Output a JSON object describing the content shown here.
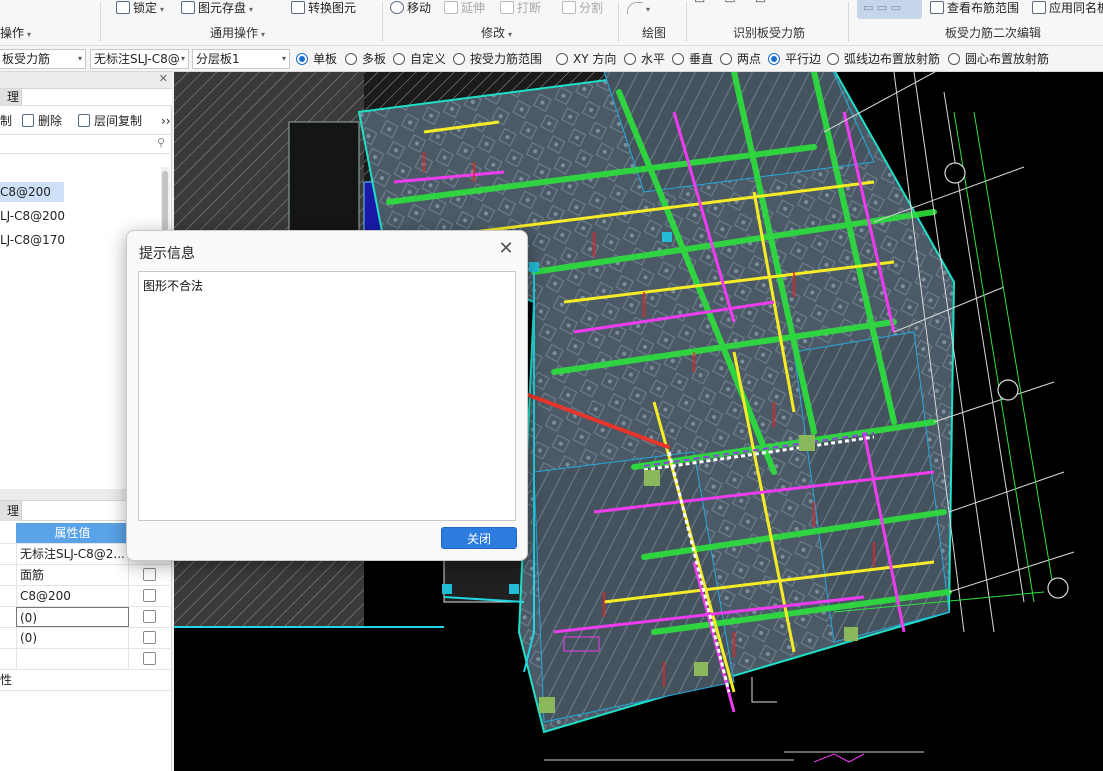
{
  "ribbon": {
    "items": [
      {
        "label": "锁定",
        "caret": true,
        "disabled": false
      },
      {
        "label": "图元存盘",
        "caret": true,
        "disabled": false
      },
      {
        "label": "转换图元",
        "caret": false,
        "disabled": false
      },
      {
        "label": "移动",
        "caret": false,
        "disabled": false
      },
      {
        "label": "延伸",
        "caret": false,
        "disabled": true
      },
      {
        "label": "打断",
        "caret": false,
        "disabled": true
      },
      {
        "label": "分割",
        "caret": false,
        "disabled": true
      },
      {
        "label": "查看布筋范围",
        "caret": false,
        "disabled": false
      },
      {
        "label": "应用同名板",
        "caret": false,
        "disabled": false
      }
    ],
    "group_labels": [
      "操作",
      "通用操作",
      "修改",
      "绘图",
      "识别板受力筋",
      "板受力筋二次编辑"
    ]
  },
  "options": {
    "combos": [
      "板受力筋",
      "无标注SLJ-C8@",
      "分层板1"
    ],
    "radios": [
      {
        "label": "单板",
        "checked": true
      },
      {
        "label": "多板",
        "checked": false
      },
      {
        "label": "自定义",
        "checked": false
      },
      {
        "label": "按受力筋范围",
        "checked": false
      },
      {
        "label": "XY 方向",
        "checked": false
      },
      {
        "label": "水平",
        "checked": false
      },
      {
        "label": "垂直",
        "checked": false
      },
      {
        "label": "两点",
        "checked": false
      },
      {
        "label": "平行边",
        "checked": true
      },
      {
        "label": "弧线边布置放射筋",
        "checked": false
      },
      {
        "label": "圆心布置放射筋",
        "checked": false
      }
    ]
  },
  "left": {
    "top_tab": "理",
    "tools": [
      "制",
      "删除",
      "层间复制"
    ],
    "more": "››",
    "tree": [
      {
        "label": "C8@200",
        "selected": true
      },
      {
        "label": "LJ-C8@200",
        "selected": false
      },
      {
        "label": "LJ-C8@170",
        "selected": false
      }
    ],
    "prop_tab": "理",
    "prop_header": "属性值",
    "props": [
      {
        "key": "",
        "value": "无标注SLJ-C8@2..."
      },
      {
        "key": "",
        "value": "面筋"
      },
      {
        "key": "",
        "value": "C8@200"
      },
      {
        "key": "",
        "value": "(0)"
      },
      {
        "key": "",
        "value": "(0)"
      },
      {
        "key": "",
        "value": ""
      },
      {
        "key": "性",
        "value": ""
      }
    ]
  },
  "dialog": {
    "title": "提示信息",
    "message": "图形不合法",
    "close_button": "关闭",
    "close_glyph": "✕"
  },
  "colors": {
    "accent": "#2d7de0",
    "arrow": "#e8352b",
    "canvas_bg": "#000000"
  }
}
